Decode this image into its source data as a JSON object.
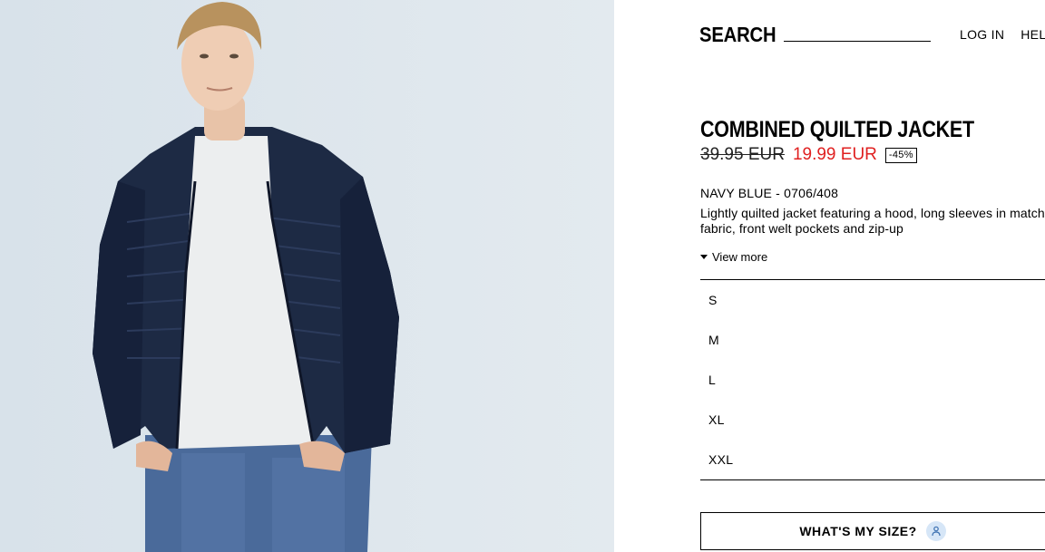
{
  "header": {
    "search_label": "SEARCH",
    "nav": [
      "LOG IN",
      "HELP"
    ]
  },
  "product": {
    "image_icon": "product-photo",
    "title": "COMBINED QUILTED JACKET",
    "price_original": "39.95 EUR",
    "price_sale": "19.99 EUR",
    "discount": "-45%",
    "color_ref": "NAVY BLUE - 0706/408",
    "description": "Lightly quilted jacket featuring a hood, long sleeves in matching fabric, front welt pockets and zip-up",
    "view_more": "View more"
  },
  "sizes": [
    "S",
    "M",
    "L",
    "XL",
    "XXL"
  ],
  "size_helper": {
    "label": "WHAT'S MY SIZE?",
    "icon": "person-icon"
  },
  "colors": {
    "sale_price": "#e02020",
    "image_background": "#dde6ec",
    "helper_icon_bg": "#d6e6f7"
  }
}
